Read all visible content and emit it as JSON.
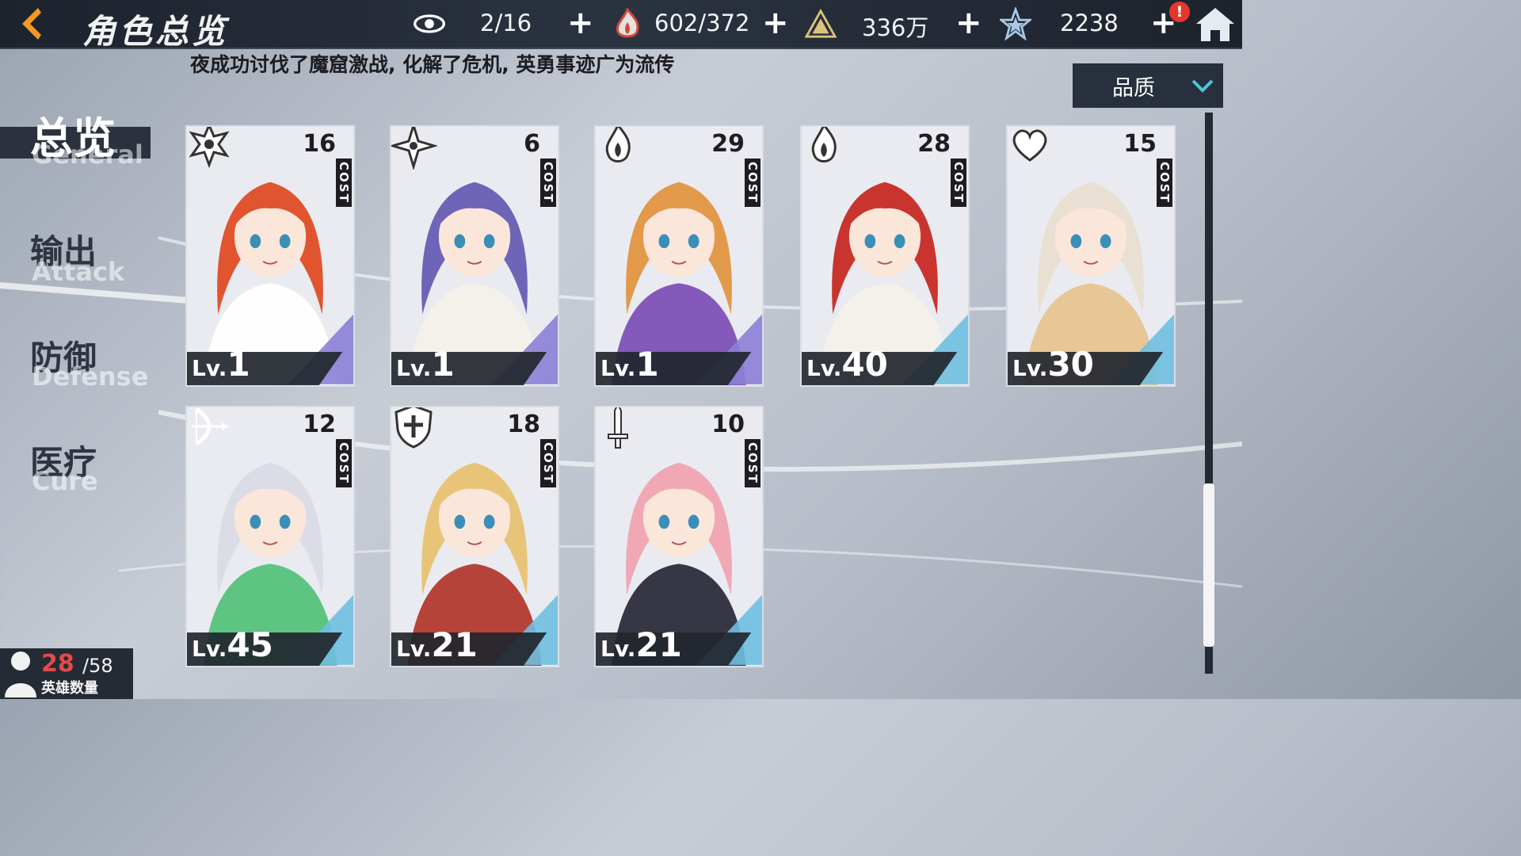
{
  "header": {
    "title": "角色总览",
    "stats": [
      {
        "icon": "eye-icon",
        "value": "2/16"
      },
      {
        "icon": "stamina-flame-icon",
        "value": "602/372"
      },
      {
        "icon": "gold-pyramid-icon",
        "value": "336万"
      },
      {
        "icon": "star-crystal-icon",
        "value": "2238"
      }
    ],
    "alert_badge": "!"
  },
  "marquee": "夜成功讨伐了魔窟激战, 化解了危机, 英勇事迹广为流传",
  "sort": {
    "label": "品质"
  },
  "nav": [
    {
      "cn": "总览",
      "en": "General",
      "active": true
    },
    {
      "cn": "输出",
      "en": "Attack",
      "active": false
    },
    {
      "cn": "防御",
      "en": "Defense",
      "active": false
    },
    {
      "cn": "医疗",
      "en": "Cure",
      "active": false
    }
  ],
  "cards": [
    {
      "cost": "16",
      "cost_label": "COST",
      "lv_prefix": "Lv.",
      "level": "1",
      "class_icon": "emblem-icon",
      "rarity_color": "#8b7fd6",
      "hair": "#e0552f",
      "outfit": "#ffffff"
    },
    {
      "cost": "6",
      "cost_label": "COST",
      "lv_prefix": "Lv.",
      "level": "1",
      "class_icon": "shuriken-icon",
      "rarity_color": "#8b7fd6",
      "hair": "#6e64b8",
      "outfit": "#f4f1ea"
    },
    {
      "cost": "29",
      "cost_label": "COST",
      "lv_prefix": "Lv.",
      "level": "1",
      "class_icon": "flame-icon",
      "rarity_color": "#8b7fd6",
      "hair": "#e3994a",
      "outfit": "#8050b8"
    },
    {
      "cost": "28",
      "cost_label": "COST",
      "lv_prefix": "Lv.",
      "level": "40",
      "class_icon": "flame-icon",
      "rarity_color": "#6fbfe0",
      "hair": "#c9342f",
      "outfit": "#f4f1ea"
    },
    {
      "cost": "15",
      "cost_label": "COST",
      "lv_prefix": "Lv.",
      "level": "30",
      "class_icon": "heart-wing-icon",
      "rarity_color": "#6fbfe0",
      "hair": "#e9e0d3",
      "outfit": "#e6c58f"
    },
    {
      "cost": "12",
      "cost_label": "COST",
      "lv_prefix": "Lv.",
      "level": "45",
      "class_icon": "bow-icon",
      "rarity_color": "#6fbfe0",
      "hair": "#dcdce6",
      "outfit": "#55c27a"
    },
    {
      "cost": "18",
      "cost_label": "COST",
      "lv_prefix": "Lv.",
      "level": "21",
      "class_icon": "shield-icon",
      "rarity_color": "#6fbfe0",
      "hair": "#e8c478",
      "outfit": "#b33a2e"
    },
    {
      "cost": "10",
      "cost_label": "COST",
      "lv_prefix": "Lv.",
      "level": "21",
      "class_icon": "sword-icon",
      "rarity_color": "#6fbfe0",
      "hair": "#f0a8b4",
      "outfit": "#2c2c3a"
    }
  ],
  "hero_count": {
    "current": "28",
    "max": "/58",
    "label": "英雄数量"
  }
}
